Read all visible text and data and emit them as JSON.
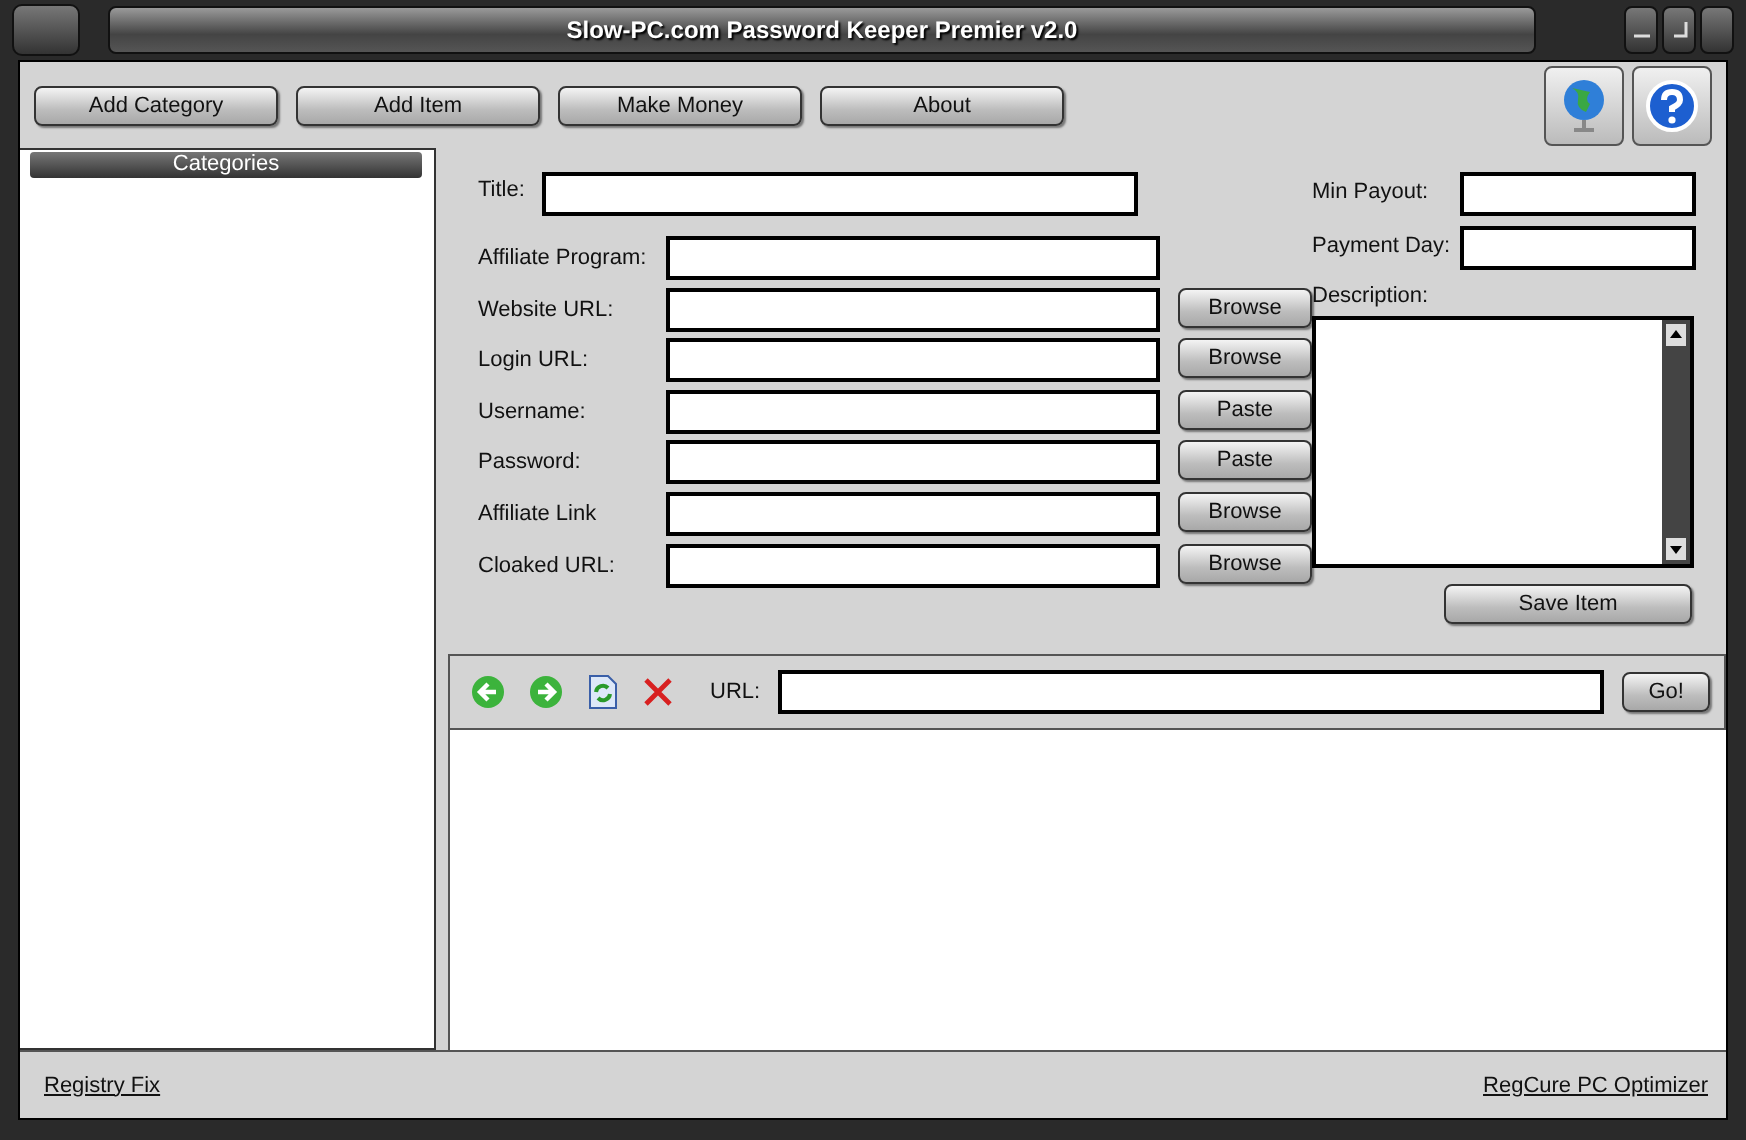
{
  "window": {
    "title": "Slow-PC.com Password Keeper Premier v2.0"
  },
  "toolbar": {
    "buttons": [
      "Add Category",
      "Add Item",
      "Make Money",
      "About"
    ]
  },
  "sidebar": {
    "header": "Categories"
  },
  "form": {
    "title_label": "Title:",
    "fields": [
      {
        "label": "Affiliate Program:"
      },
      {
        "label": "Website URL:",
        "button": "Browse"
      },
      {
        "label": "Login URL:",
        "button": "Browse"
      },
      {
        "label": "Username:",
        "button": "Paste"
      },
      {
        "label": "Password:",
        "button": "Paste"
      },
      {
        "label": "Affiliate Link",
        "button": "Browse"
      },
      {
        "label": "Cloaked URL:",
        "button": "Browse"
      }
    ],
    "side_fields": [
      {
        "label": "Min Payout:"
      },
      {
        "label": "Payment Day:"
      }
    ],
    "description_label": "Description:",
    "save_button": "Save Item"
  },
  "browser": {
    "url_label": "URL:",
    "go_button": "Go!"
  },
  "footer": {
    "links": [
      "Registry Fix",
      "RegCure PC Optimizer"
    ]
  }
}
